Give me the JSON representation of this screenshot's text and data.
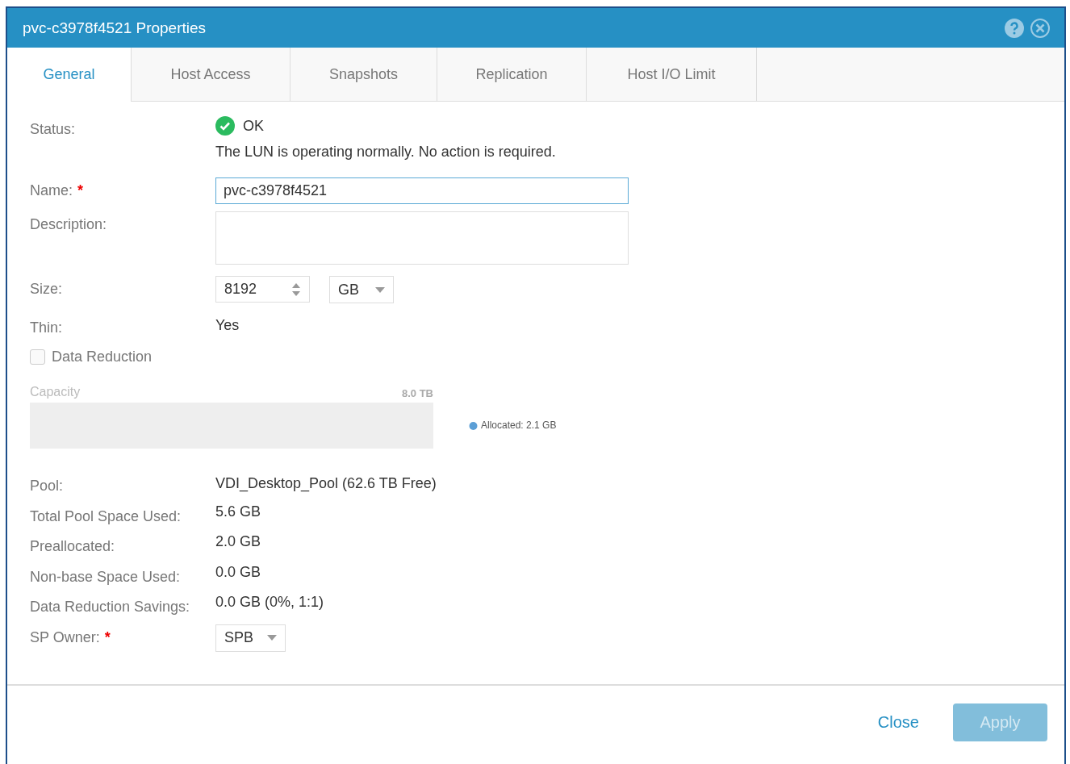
{
  "window": {
    "title": "pvc-c3978f4521 Properties"
  },
  "tabs": [
    {
      "label": "General",
      "selected": true
    },
    {
      "label": "Host Access",
      "selected": false
    },
    {
      "label": "Snapshots",
      "selected": false
    },
    {
      "label": "Replication",
      "selected": false
    },
    {
      "label": "Host I/O Limit",
      "selected": false
    }
  ],
  "status": {
    "label": "Status:",
    "value": "OK",
    "message": "The LUN is operating normally. No action is required."
  },
  "name": {
    "label": "Name:",
    "required_mark": "*",
    "value": "pvc-c3978f4521"
  },
  "description": {
    "label": "Description:"
  },
  "size": {
    "label": "Size:",
    "value": "8192",
    "unit": "GB"
  },
  "thin": {
    "label": "Thin:",
    "value": "Yes"
  },
  "data_reduction": {
    "label": "Data Reduction",
    "checked": false
  },
  "capacity": {
    "title": "Capacity",
    "total": "8.0 TB",
    "legend": "Allocated: 2.1 GB"
  },
  "details": [
    {
      "label": "Pool:",
      "value": "VDI_Desktop_Pool (62.6 TB Free)"
    },
    {
      "label": "Total Pool Space Used:",
      "value": "5.6 GB"
    },
    {
      "label": "Preallocated:",
      "value": "2.0 GB"
    },
    {
      "label": "Non-base Space Used:",
      "value": "0.0 GB"
    },
    {
      "label": "Data Reduction Savings:",
      "value": "0.0 GB (0%, 1:1)"
    }
  ],
  "sp_owner": {
    "label": "SP Owner:",
    "required_mark": "*",
    "value": "SPB"
  },
  "buttons": [
    {
      "label": "Close",
      "kind": "link",
      "disabled": false
    },
    {
      "label": "Apply",
      "kind": "primary",
      "disabled": true
    }
  ]
}
